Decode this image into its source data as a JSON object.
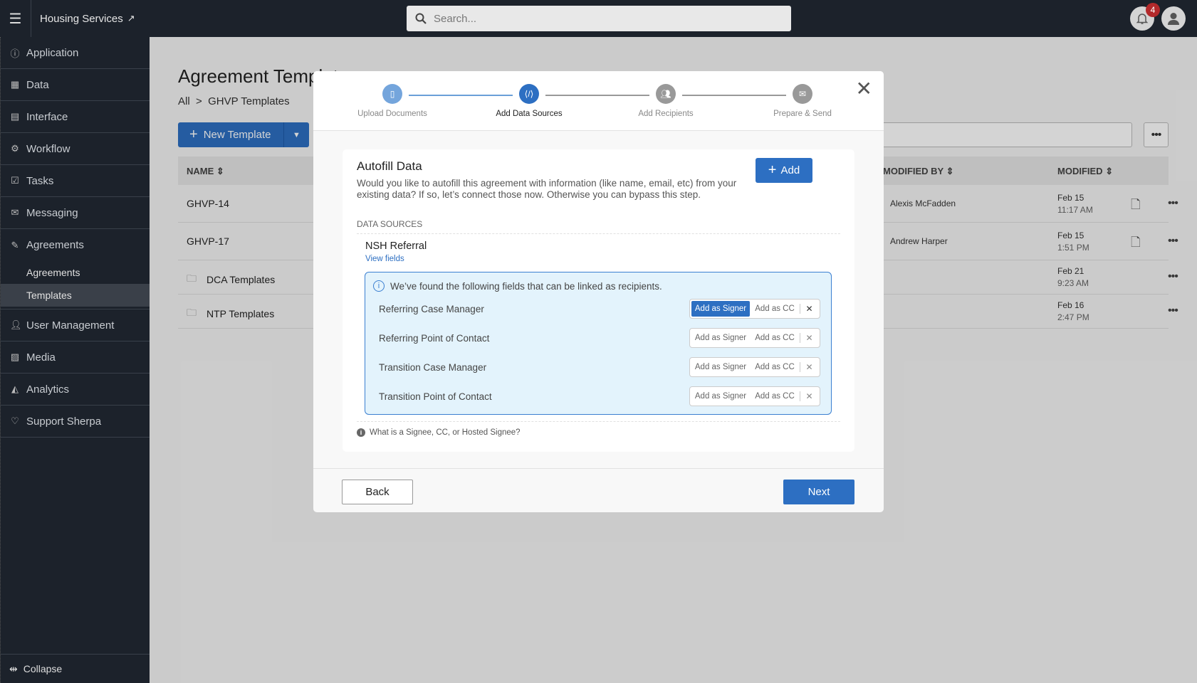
{
  "topbar": {
    "app_title": "Housing Services",
    "search_placeholder": "Search...",
    "notification_count": "4"
  },
  "sidebar": {
    "items": [
      {
        "label": "Application",
        "icon": "info-circle-icon"
      },
      {
        "label": "Data",
        "icon": "table-icon"
      },
      {
        "label": "Interface",
        "icon": "layout-icon"
      },
      {
        "label": "Workflow",
        "icon": "workflow-icon"
      },
      {
        "label": "Tasks",
        "icon": "checkbox-icon"
      },
      {
        "label": "Messaging",
        "icon": "envelope-icon"
      },
      {
        "label": "Agreements",
        "icon": "signature-icon"
      }
    ],
    "sub_items": [
      {
        "label": "Agreements"
      },
      {
        "label": "Templates",
        "active": true
      }
    ],
    "items2": [
      {
        "label": "User Management",
        "icon": "user-icon"
      },
      {
        "label": "Media",
        "icon": "image-icon"
      },
      {
        "label": "Analytics",
        "icon": "chart-icon"
      },
      {
        "label": "Support Sherpa",
        "icon": "heart-icon"
      }
    ],
    "collapse_label": "Collapse"
  },
  "page": {
    "title": "Agreement Templates",
    "breadcrumb": [
      "All",
      "GHVP Templates"
    ],
    "new_template_label": "New Template",
    "columns": {
      "name": "NAME",
      "modified_by": "MODIFIED BY",
      "modified": "MODIFIED"
    },
    "rows": [
      {
        "name": "GHVP-14",
        "type": "template",
        "modified_by": "Alexis McFadden",
        "date": "Feb 15",
        "time": "11:17 AM"
      },
      {
        "name": "GHVP-17",
        "type": "template",
        "modified_by": "Andrew Harper",
        "date": "Feb 15",
        "time": "1:51 PM"
      },
      {
        "name": "DCA Templates",
        "type": "folder",
        "modified_by": "",
        "date": "Feb 21",
        "time": "9:23 AM"
      },
      {
        "name": "NTP Templates",
        "type": "folder",
        "modified_by": "",
        "date": "Feb 16",
        "time": "2:47 PM"
      }
    ]
  },
  "modal": {
    "steps": [
      {
        "label": "Upload Documents",
        "state": "done"
      },
      {
        "label": "Add Data Sources",
        "state": "active"
      },
      {
        "label": "Add Recipients",
        "state": "pending"
      },
      {
        "label": "Prepare & Send",
        "state": "pending"
      }
    ],
    "title": "Autofill Data",
    "description": "Would you like to autofill this agreement with information (like name, email, etc) from your existing data? If so, let’s connect those now. Otherwise you can bypass this step.",
    "add_label": "Add",
    "data_sources_label": "DATA SOURCES",
    "source_name": "NSH Referral",
    "view_fields_label": "View fields",
    "info_text": "We’ve found the following fields that can be linked as recipients.",
    "signer_label": "Add as Signer",
    "cc_label": "Add as CC",
    "fields": [
      {
        "label": "Referring Case Manager",
        "selected": "signer"
      },
      {
        "label": "Referring Point of Contact",
        "selected": ""
      },
      {
        "label": "Transition Case Manager",
        "selected": ""
      },
      {
        "label": "Transition Point of Contact",
        "selected": ""
      }
    ],
    "help_text": "What is a Signee, CC, or Hosted Signee?",
    "back_label": "Back",
    "next_label": "Next"
  },
  "colors": {
    "primary": "#2d6fc2",
    "sidebar": "#1c222b",
    "badge": "#b3292b",
    "info_bg": "#e3f3fc"
  }
}
